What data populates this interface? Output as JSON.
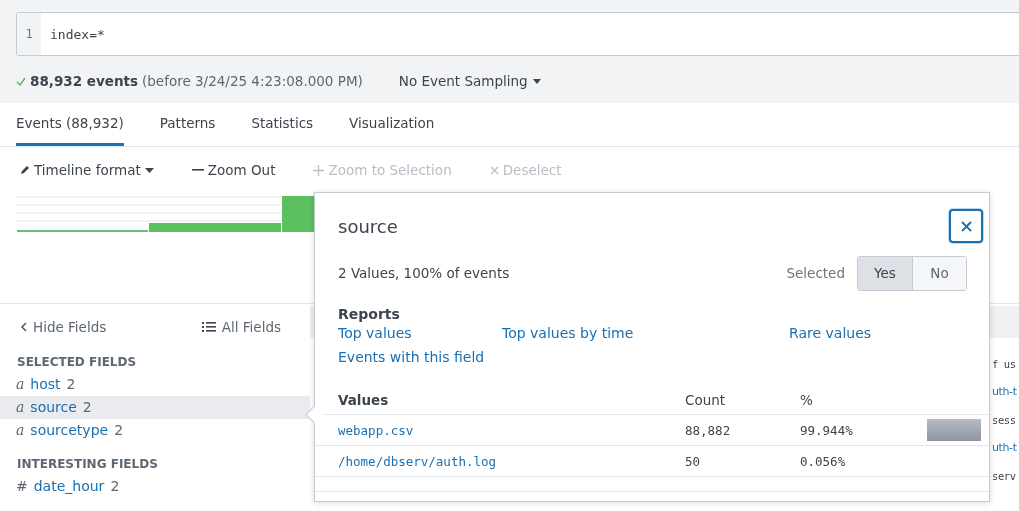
{
  "search": {
    "line_number": "1",
    "query": "index=*"
  },
  "status": {
    "count": "88,932 events",
    "range": "(before 3/24/25 4:23:08.000 PM)",
    "sampling": "No Event Sampling"
  },
  "tabs": [
    {
      "label": "Events (88,932)",
      "selected": true
    },
    {
      "label": "Patterns",
      "selected": false
    },
    {
      "label": "Statistics",
      "selected": false
    },
    {
      "label": "Visualization",
      "selected": false
    }
  ],
  "toolbar": [
    {
      "kind": "format",
      "label": "Timeline format",
      "disabled": false
    },
    {
      "kind": "zoom_out",
      "label": "Zoom Out",
      "disabled": false
    },
    {
      "kind": "zoom_select",
      "label": "Zoom to Selection",
      "disabled": true
    },
    {
      "kind": "deselect",
      "label": "Deselect",
      "disabled": true
    }
  ],
  "sidebar": {
    "hide": "Hide Fields",
    "all": "All Fields",
    "sections": [
      {
        "title": "SELECTED FIELDS",
        "fields": [
          {
            "type": "a",
            "name": "host",
            "count": "2",
            "selected": false
          },
          {
            "type": "a",
            "name": "source",
            "count": "2",
            "selected": true
          },
          {
            "type": "a",
            "name": "sourcetype",
            "count": "2",
            "selected": false
          }
        ]
      },
      {
        "title": "INTERESTING FIELDS",
        "fields": [
          {
            "type": "#",
            "name": "date_hour",
            "count": "2",
            "selected": false
          }
        ]
      }
    ]
  },
  "events": [
    {
      "kind": "code",
      "text": "f us"
    },
    {
      "kind": "link",
      "text": "uth-t"
    },
    {
      "kind": "code",
      "text": "sess"
    },
    {
      "kind": "link",
      "text": "uth-t"
    },
    {
      "kind": "code",
      "text": "serv"
    }
  ],
  "popup": {
    "title": "source",
    "summary": "2 Values, 100% of events",
    "selected_label": "Selected",
    "toggle": [
      {
        "label": "Yes",
        "selected": true
      },
      {
        "label": "No",
        "selected": false
      }
    ],
    "reports_title": "Reports",
    "reports": [
      "Top values",
      "Top values by time",
      "Rare values",
      "Events with this field"
    ],
    "columns": [
      "Values",
      "Count",
      "%"
    ],
    "values": [
      {
        "value": "webapp.csv",
        "count": "88,882",
        "percent": "99.944%",
        "level": 0.99944
      },
      {
        "value": "/home/dbserv/auth.log",
        "count": "50",
        "percent": "0.056%"
      }
    ]
  }
}
